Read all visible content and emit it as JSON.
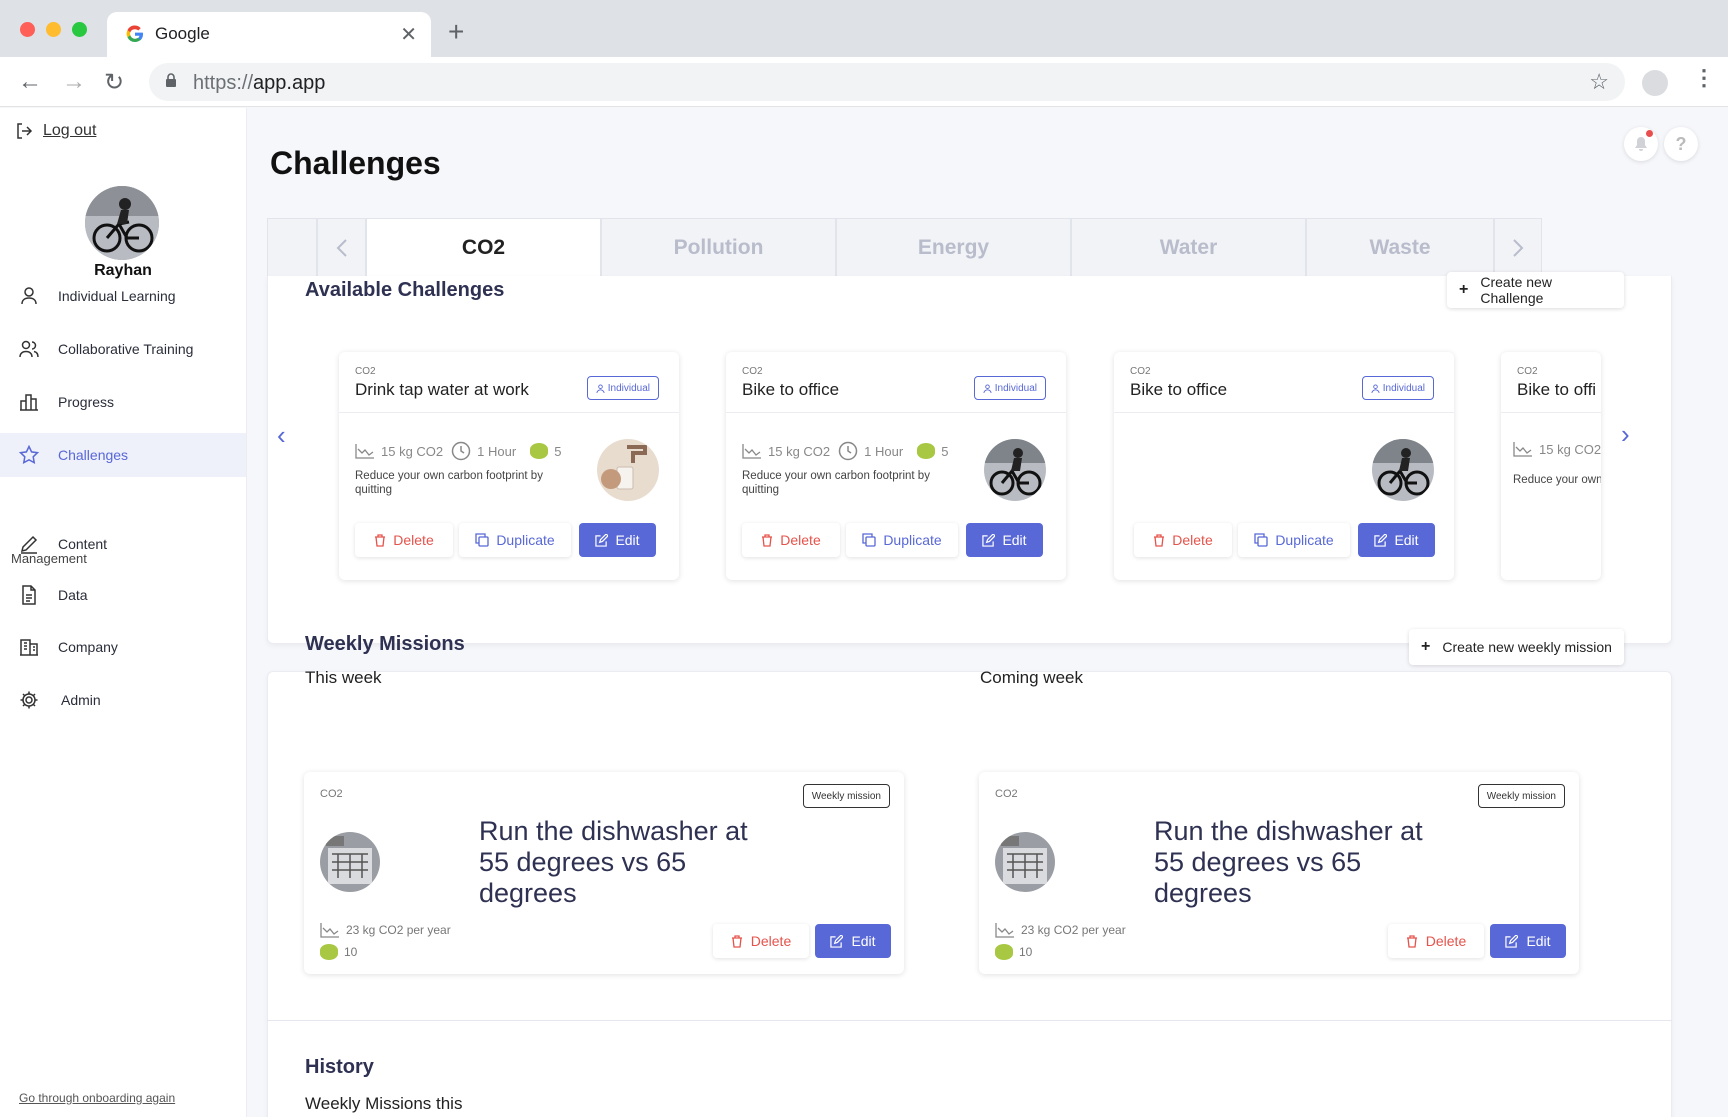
{
  "browser": {
    "tab_title": "Google",
    "url_protocol": "https://",
    "url_host": "app.app"
  },
  "sidebar": {
    "logout": "Log out",
    "username": "Rayhan",
    "items": [
      {
        "label": "Individual Learning",
        "icon": "person-icon"
      },
      {
        "label": "Collaborative Training",
        "icon": "people-icon"
      },
      {
        "label": "Progress",
        "icon": "bar-chart-icon"
      },
      {
        "label": "Challenges",
        "icon": "star-icon",
        "active": true
      }
    ],
    "management_label": "Management",
    "management_items": [
      {
        "label": "Content",
        "icon": "pencil-icon"
      },
      {
        "label": "Data",
        "icon": "document-icon"
      },
      {
        "label": "Company",
        "icon": "building-icon"
      },
      {
        "label": "Admin",
        "icon": "gear-icon"
      }
    ],
    "onboarding": "Go through onboarding again"
  },
  "page": {
    "title": "Challenges",
    "help": "?"
  },
  "tabs": [
    {
      "label": "CO2",
      "active": true
    },
    {
      "label": "Pollution"
    },
    {
      "label": "Energy"
    },
    {
      "label": "Water"
    },
    {
      "label": "Waste"
    }
  ],
  "available": {
    "title": "Available Challenges",
    "create_label": "Create new Challenge",
    "cards": [
      {
        "category": "CO2",
        "title": "Drink tap water at work",
        "badge": "Individual",
        "co2": "15 kg CO2",
        "time": "1 Hour",
        "points": "5",
        "description": "Reduce your own carbon footprint by quitting",
        "delete": "Delete",
        "duplicate": "Duplicate",
        "edit": "Edit"
      },
      {
        "category": "CO2",
        "title": "Bike to office",
        "badge": "Individual",
        "co2": "15 kg CO2",
        "time": "1 Hour",
        "points": "5",
        "description": "Reduce your own carbon footprint by quitting",
        "delete": "Delete",
        "duplicate": "Duplicate",
        "edit": "Edit"
      },
      {
        "category": "CO2",
        "title": "Bike to office",
        "badge": "Individual",
        "delete": "Delete",
        "duplicate": "Duplicate",
        "edit": "Edit"
      },
      {
        "category": "CO2",
        "title": "Bike to offi",
        "co2": "15 kg CO2",
        "description": "Reduce your own"
      }
    ]
  },
  "weekly": {
    "title": "Weekly Missions",
    "create_label": "Create new weekly mission",
    "this_week": "This week",
    "coming_week": "Coming week",
    "missions": [
      {
        "category": "CO2",
        "badge": "Weekly mission",
        "title": "Run the dishwasher at 55 degrees vs 65 degrees",
        "co2": "23 kg CO2 per year",
        "points": "10",
        "delete": "Delete",
        "edit": "Edit"
      },
      {
        "category": "CO2",
        "badge": "Weekly mission",
        "title": "Run the dishwasher at 55 degrees vs 65 degrees",
        "co2": "23 kg CO2 per year",
        "points": "10",
        "delete": "Delete",
        "edit": "Edit"
      }
    ]
  },
  "history": {
    "title": "History",
    "subtitle": "Weekly Missions this"
  },
  "colors": {
    "accent": "#5868d6",
    "danger": "#e5534b",
    "coin": "#a8c843"
  }
}
